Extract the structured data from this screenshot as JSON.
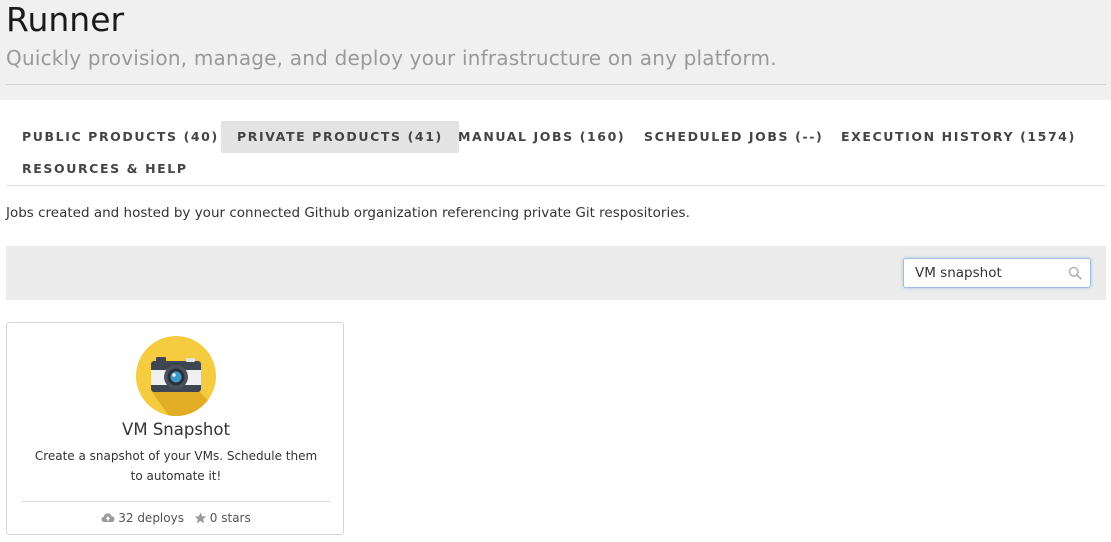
{
  "header": {
    "title": "Runner",
    "subtitle": "Quickly provision, manage, and deploy your infrastructure on any platform."
  },
  "tabs": [
    {
      "label": "PUBLIC PRODUCTS (40)",
      "active": false
    },
    {
      "label": "PRIVATE PRODUCTS (41)",
      "active": true
    },
    {
      "label": "MANUAL JOBS (160)",
      "active": false
    },
    {
      "label": "SCHEDULED JOBS (--)",
      "active": false
    },
    {
      "label": "EXECUTION HISTORY (1574)",
      "active": false
    },
    {
      "label": "RESOURCES & HELP",
      "active": false
    }
  ],
  "description": "Jobs created and hosted by your connected Github organization referencing private Git respositories.",
  "search": {
    "value": "VM snapshot",
    "icon": "search-icon"
  },
  "cards": [
    {
      "title": "VM Snapshot",
      "description": "Create a snapshot of your VMs. Schedule them to automate it!",
      "icon": "camera-icon",
      "deploys": "32 deploys",
      "stars": "0 stars"
    }
  ],
  "colors": {
    "header_bg": "#f0f0f0",
    "active_tab_bg": "#e3e3e3",
    "icon_circle": "#f5cc3f",
    "search_focus_border": "#9cc0e6"
  }
}
